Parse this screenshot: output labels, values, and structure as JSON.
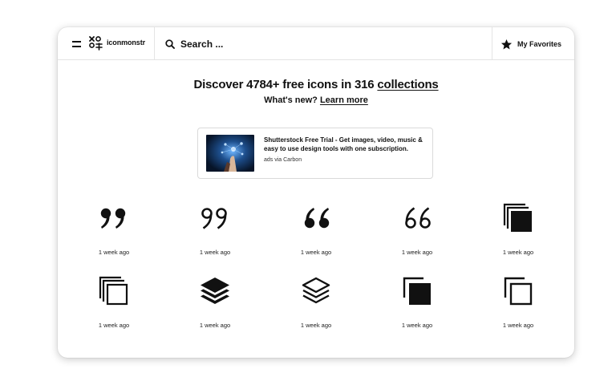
{
  "brand": {
    "name": "iconmonstr"
  },
  "search": {
    "placeholder": "Search ..."
  },
  "favorites": {
    "label": "My Favorites"
  },
  "hero": {
    "prefix": "Discover 4784+ free icons in 316 ",
    "link": "collections",
    "sub_prefix": "What's new? ",
    "sub_link": "Learn more"
  },
  "ad": {
    "text": "Shutterstock Free Trial - Get images, video, music & easy to use design tools with one subscription.",
    "via": "ads via Carbon"
  },
  "icons": [
    {
      "icon": "quote-right-filled-icon",
      "time": "1 week ago"
    },
    {
      "icon": "quote-right-outline-icon",
      "time": "1 week ago"
    },
    {
      "icon": "quote-left-filled-icon",
      "time": "1 week ago"
    },
    {
      "icon": "quote-left-outline-icon",
      "time": "1 week ago"
    },
    {
      "icon": "copy-stack-filled-icon",
      "time": "1 week ago"
    },
    {
      "icon": "copy-stack-outline-icon",
      "time": "1 week ago"
    },
    {
      "icon": "layers-filled-icon",
      "time": "1 week ago"
    },
    {
      "icon": "layers-outline-icon",
      "time": "1 week ago"
    },
    {
      "icon": "duplicate-filled-icon",
      "time": "1 week ago"
    },
    {
      "icon": "duplicate-outline-icon",
      "time": "1 week ago"
    }
  ],
  "colors": {
    "text": "#111111",
    "border": "#e4e4e4",
    "background": "#ffffff"
  }
}
